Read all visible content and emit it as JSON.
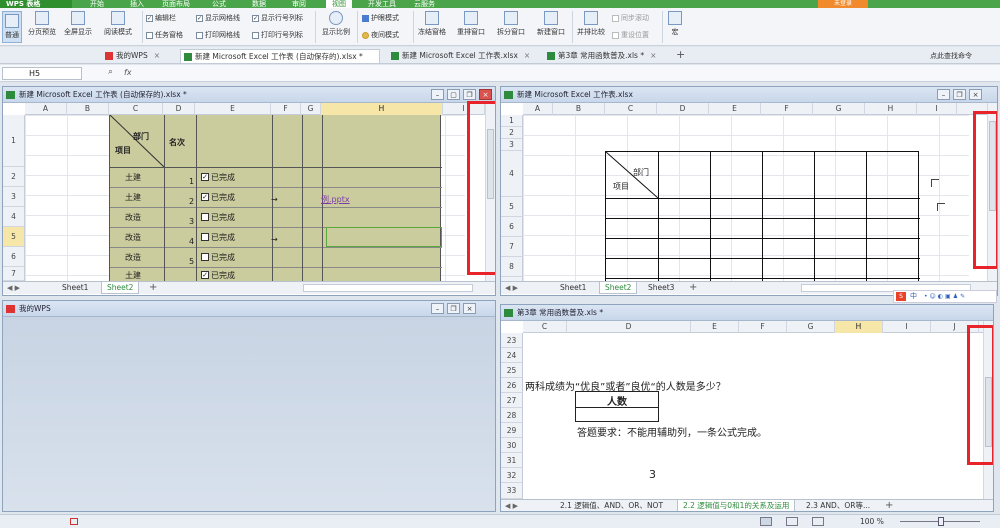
{
  "menubar": {
    "app": "WPS 表格",
    "items": [
      "开始",
      "插入",
      "页面布局",
      "公式",
      "数据",
      "审阅",
      "视图",
      "开发工具",
      "云服务"
    ],
    "selected": "视图",
    "login": "未登录"
  },
  "ribbon": {
    "normal": "普通",
    "page_break_preview": "分页预览",
    "full_screen": "全屏显示",
    "reading_mode": "阅读模式",
    "edit_bar": "编辑栏",
    "task_pane": "任务窗格",
    "show_gridlines": "显示网格线",
    "print_gridlines": "打印网格线",
    "show_row_col_headers": "显示行号列标",
    "print_row_col_headers": "打印行号列标",
    "zoom": "显示比例",
    "eye_protection": "护眼模式",
    "night_mode": "夜间模式",
    "freeze_panes": "冻结窗格",
    "arrange_window": "重排窗口",
    "split_window": "拆分窗口",
    "new_window": "新建窗口",
    "side_by_side": "并排比较",
    "sync_scroll": "同步滚动",
    "reset_position": "重设位置",
    "macro": "宏"
  },
  "doctabs": {
    "tabs": [
      {
        "label": "我的WPS"
      },
      {
        "label": "新建 Microsoft Excel 工作表 (自动保存的).xlsx *"
      },
      {
        "label": "新建 Microsoft Excel 工作表.xlsx"
      },
      {
        "label": "第3章 常用函数普及.xls *"
      }
    ],
    "add": "+",
    "search": "点此查找命令"
  },
  "formula": {
    "namebox": "H5",
    "fx": "fx"
  },
  "win1": {
    "title": "新建 Microsoft Excel 工作表 (自动保存的).xlsx *",
    "cols": [
      "A",
      "B",
      "C",
      "D",
      "E",
      "F",
      "G",
      "H",
      "I"
    ],
    "rows": [
      "1",
      "2",
      "3",
      "4",
      "5",
      "6",
      "7"
    ],
    "header_dept": "部门",
    "header_item": "项目",
    "header_rank": "名次",
    "items": [
      "土建",
      "土建",
      "改造",
      "改造",
      "改造",
      "土建"
    ],
    "ranks": [
      "1",
      "2",
      "3",
      "4",
      "5"
    ],
    "status": [
      "已完成",
      "已完成",
      "已完成",
      "已完成",
      "已完成",
      "已完成"
    ],
    "arrow": "→",
    "link": "例.pptx",
    "sheets": [
      "Sheet1",
      "Sheet2"
    ]
  },
  "win2": {
    "title": "新建 Microsoft Excel 工作表.xlsx",
    "cols": [
      "A",
      "B",
      "C",
      "D",
      "E",
      "F",
      "G",
      "H",
      "I"
    ],
    "rows": [
      "1",
      "2",
      "3",
      "4",
      "5",
      "6",
      "7",
      "8"
    ],
    "header_dept": "部门",
    "header_item": "项目",
    "sheets": [
      "Sheet1",
      "Sheet2",
      "Sheet3"
    ]
  },
  "win3": {
    "title": "我的WPS"
  },
  "win4": {
    "title": "第3章 常用函数普及.xls *",
    "cols": [
      "C",
      "D",
      "E",
      "F",
      "G",
      "H",
      "I",
      "J"
    ],
    "rows": [
      "23",
      "24",
      "25",
      "26",
      "27",
      "28",
      "29",
      "30",
      "31",
      "32",
      "33"
    ],
    "question": "两科成绩为“优良”或者”良优“的人数是多少？",
    "table_header": "人数",
    "requirement": "答题要求：不能用辅助列，一条公式完成。",
    "number": "3",
    "sheets": [
      "2.1 逻辑值、AND、OR、NOT",
      "2.2 逻辑值与0和1的关系及运用",
      "2.3 AND、OR等..."
    ]
  },
  "ime": {
    "label": "中"
  },
  "status": {
    "zoom": "100 %"
  }
}
